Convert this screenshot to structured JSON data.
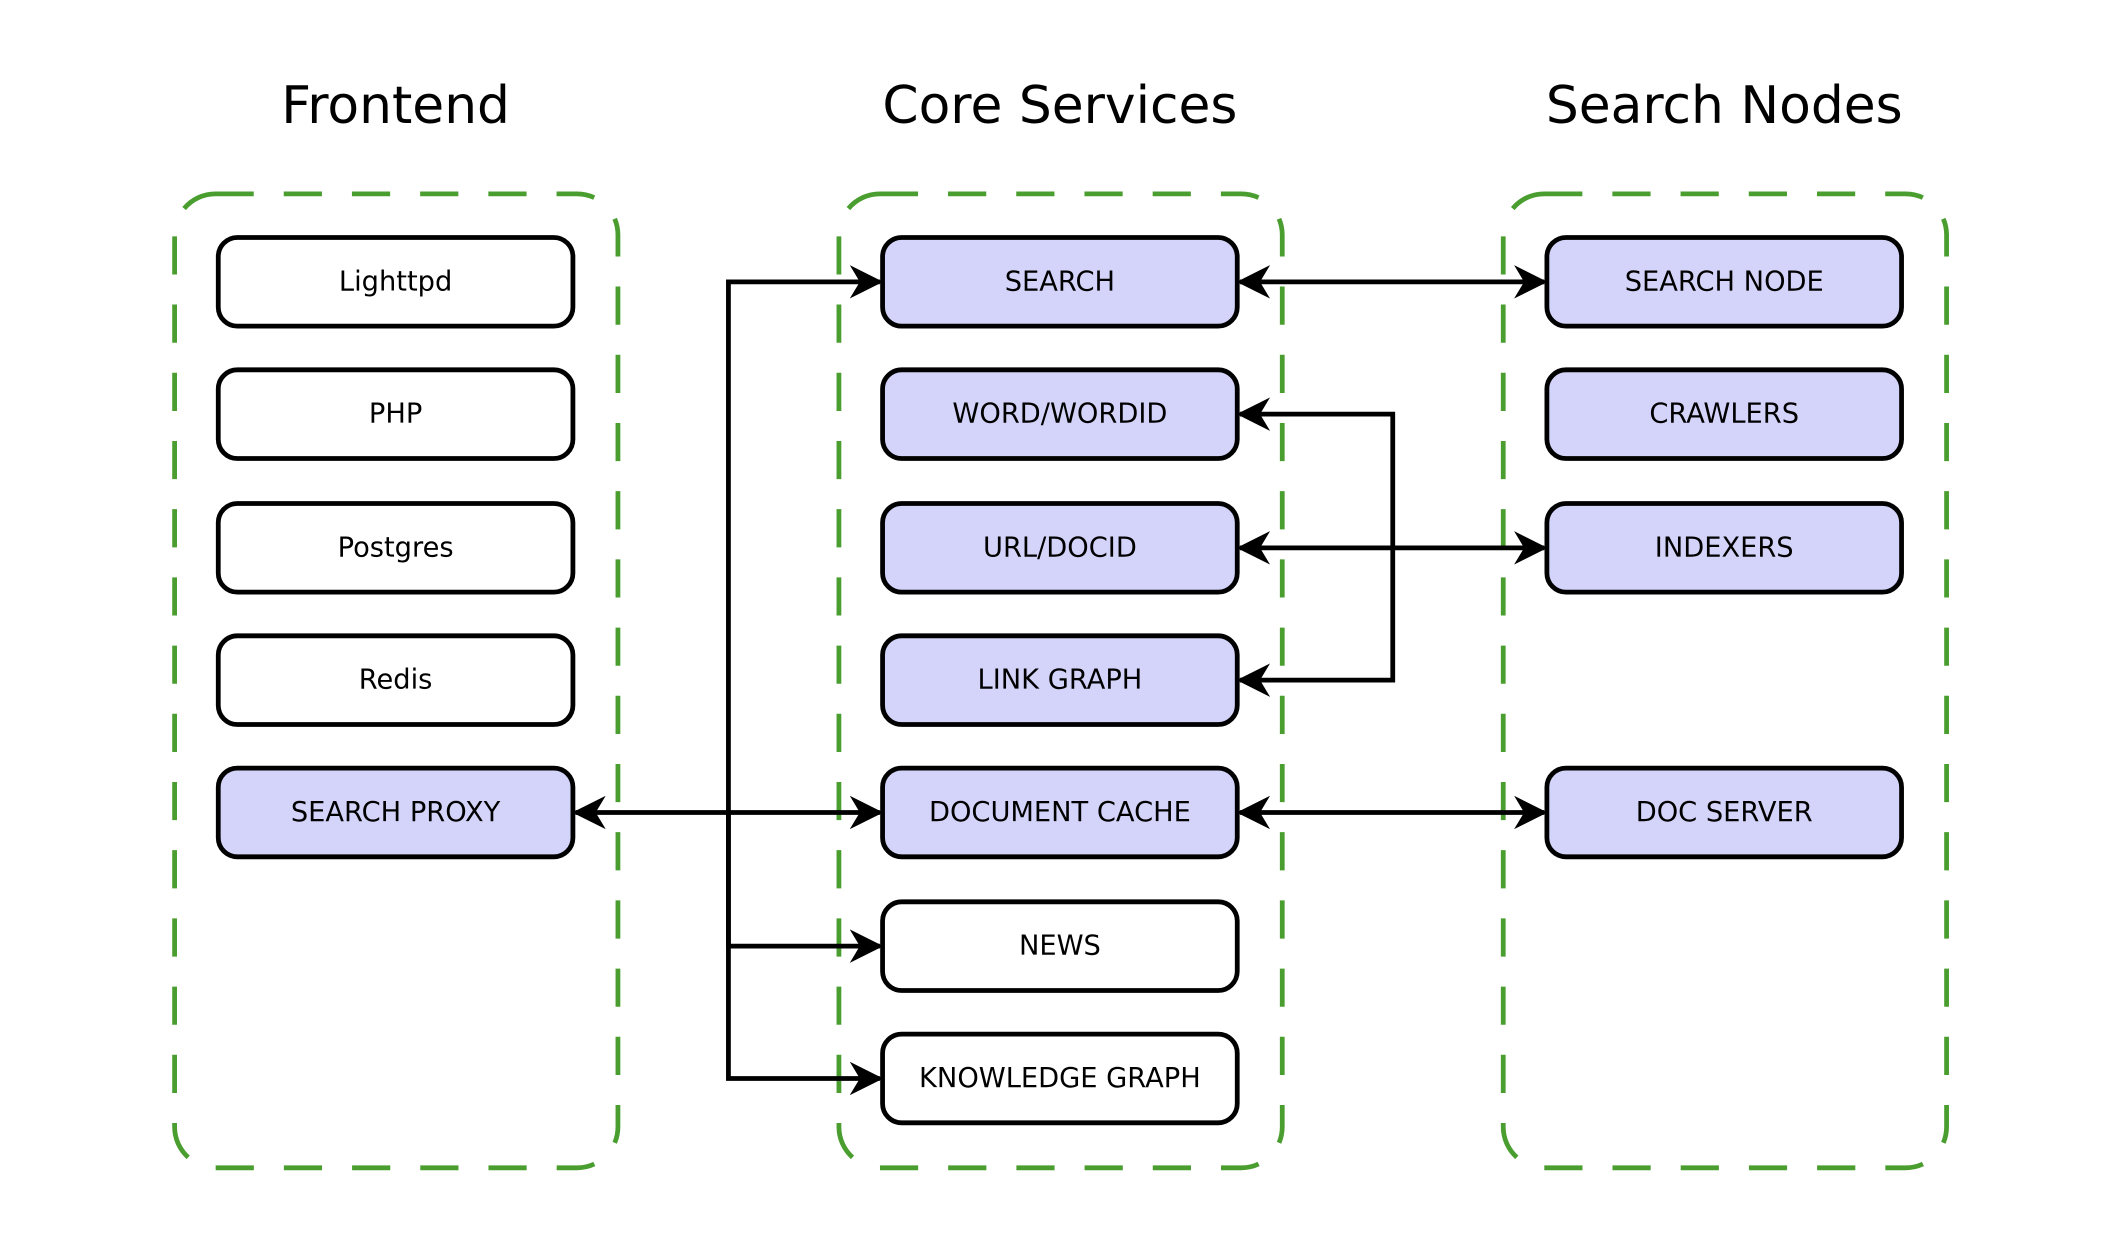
{
  "colors": {
    "group_border": "#4a9e2f",
    "highlight_fill": "#d4d4fa",
    "plain_fill": "#ffffff"
  },
  "groups": [
    {
      "title": "Frontend",
      "nodes": [
        {
          "label": "Lighttpd",
          "highlight": false
        },
        {
          "label": "PHP",
          "highlight": false
        },
        {
          "label": "Postgres",
          "highlight": false
        },
        {
          "label": "Redis",
          "highlight": false
        },
        {
          "label": "SEARCH PROXY",
          "highlight": true
        }
      ]
    },
    {
      "title": "Core Services",
      "nodes": [
        {
          "label": "SEARCH",
          "highlight": true
        },
        {
          "label": "WORD/WORDID",
          "highlight": true
        },
        {
          "label": "URL/DOCID",
          "highlight": true
        },
        {
          "label": "LINK GRAPH",
          "highlight": true
        },
        {
          "label": "DOCUMENT CACHE",
          "highlight": true
        },
        {
          "label": "NEWS",
          "highlight": false
        },
        {
          "label": "KNOWLEDGE GRAPH",
          "highlight": false
        }
      ]
    },
    {
      "title": "Search Nodes",
      "nodes": [
        {
          "label": "SEARCH NODE",
          "highlight": true,
          "row": 0
        },
        {
          "label": "CRAWLERS",
          "highlight": true,
          "row": 1
        },
        {
          "label": "INDEXERS",
          "highlight": true,
          "row": 2
        },
        {
          "label": "DOC SERVER",
          "highlight": true,
          "row": 4
        }
      ]
    }
  ],
  "edges": [
    {
      "from": "SEARCH PROXY",
      "to": "SEARCH",
      "bidirectional": false
    },
    {
      "from": "SEARCH PROXY",
      "to": "DOCUMENT CACHE",
      "bidirectional": true
    },
    {
      "from": "SEARCH PROXY",
      "to": "NEWS",
      "bidirectional": false
    },
    {
      "from": "SEARCH PROXY",
      "to": "KNOWLEDGE GRAPH",
      "bidirectional": false
    },
    {
      "from": "SEARCH",
      "to": "SEARCH NODE",
      "bidirectional": true
    },
    {
      "from": "INDEXERS",
      "to": "WORD/WORDID",
      "bidirectional": false
    },
    {
      "from": "INDEXERS",
      "to": "URL/DOCID",
      "bidirectional": true
    },
    {
      "from": "INDEXERS",
      "to": "LINK GRAPH",
      "bidirectional": false
    },
    {
      "from": "DOCUMENT CACHE",
      "to": "DOC SERVER",
      "bidirectional": true
    }
  ]
}
